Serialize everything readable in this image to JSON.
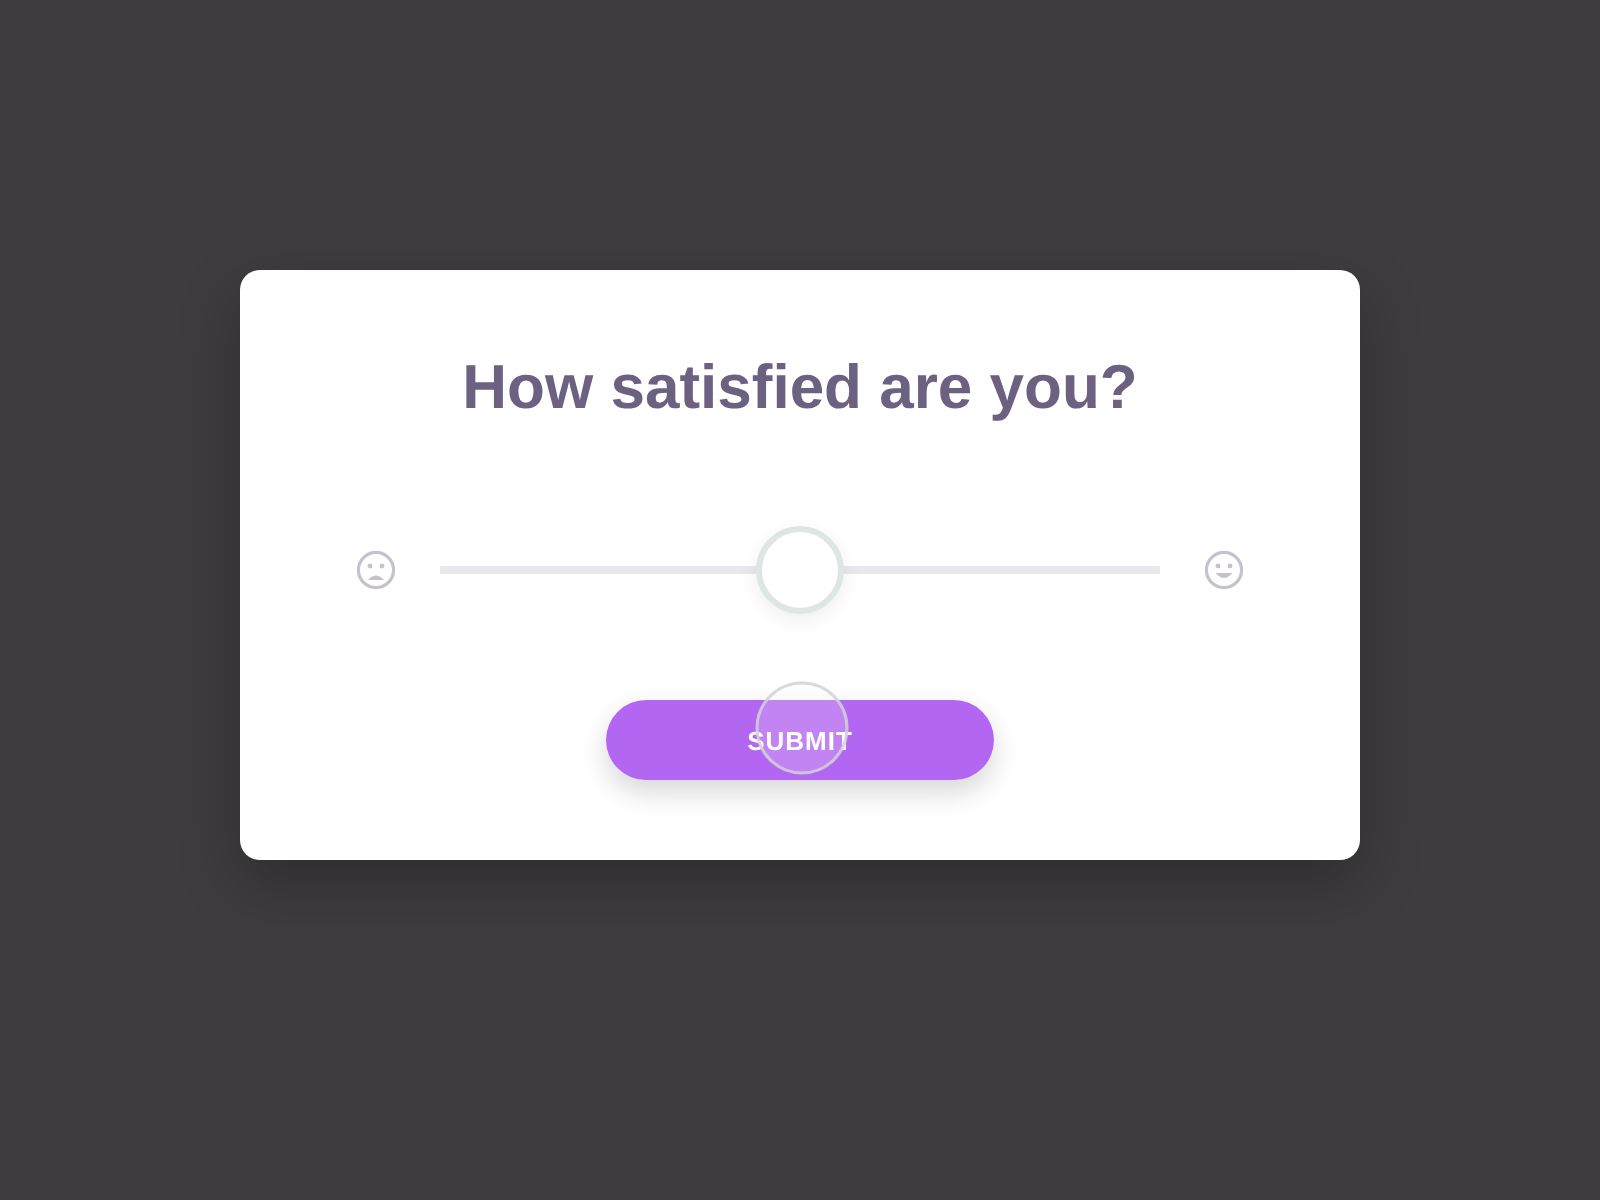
{
  "survey": {
    "title": "How satisfied are you?",
    "slider": {
      "level": 0.5
    },
    "submit": {
      "label": "SUBMIT"
    }
  }
}
